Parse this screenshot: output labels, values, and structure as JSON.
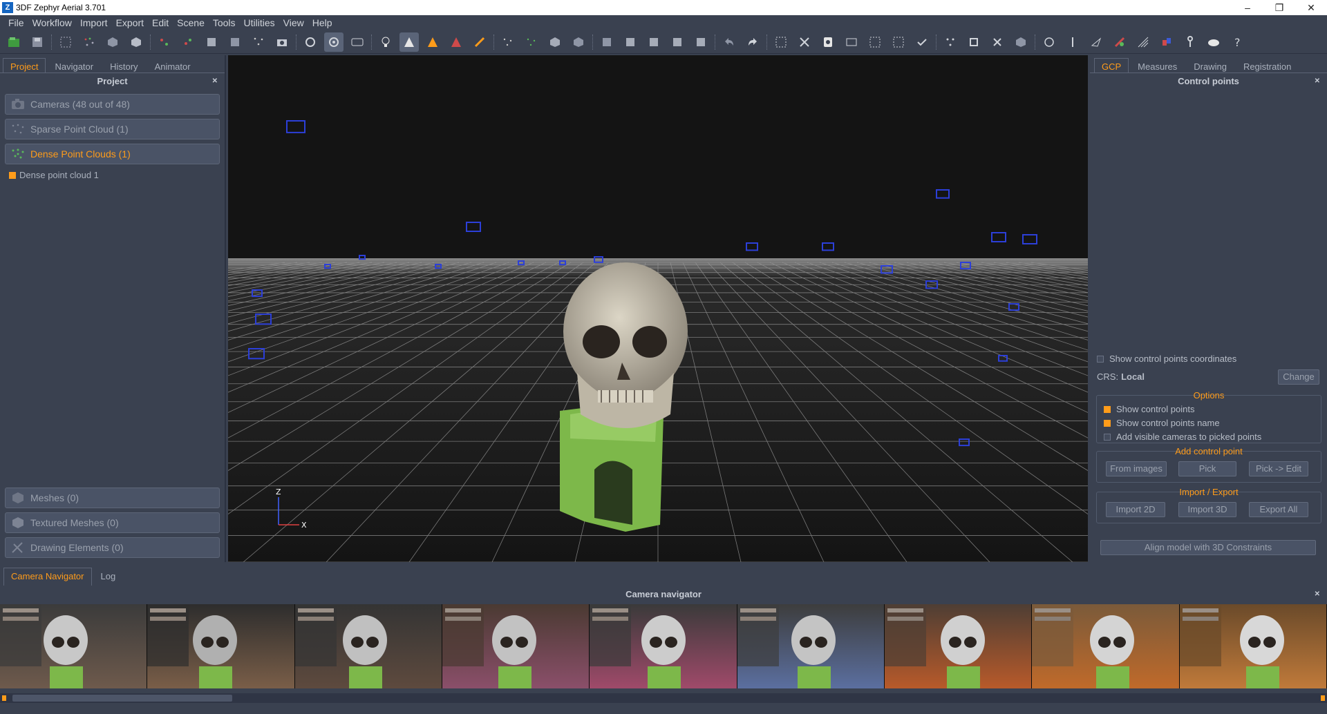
{
  "window": {
    "title": "3DF Zephyr Aerial 3.701",
    "logo_letter": "Z",
    "controls": [
      "–",
      "❐",
      "✕"
    ]
  },
  "menu": [
    "File",
    "Workflow",
    "Import",
    "Export",
    "Edit",
    "Scene",
    "Tools",
    "Utilities",
    "View",
    "Help"
  ],
  "left_panel": {
    "tabs": [
      "Project",
      "Navigator",
      "History",
      "Animator"
    ],
    "title": "Project",
    "sections_top": [
      {
        "label": "Cameras (48 out of 48)",
        "icon": "camera-icon"
      },
      {
        "label": "Sparse Point Cloud (1)",
        "icon": "sparse-cloud-icon"
      },
      {
        "label": "Dense Point Clouds (1)",
        "icon": "dense-cloud-icon"
      }
    ],
    "tree_item": "Dense point cloud 1",
    "sections_bottom": [
      {
        "label": "Meshes (0)",
        "icon": "mesh-icon"
      },
      {
        "label": "Textured Meshes (0)",
        "icon": "textured-mesh-icon"
      },
      {
        "label": "Drawing Elements (0)",
        "icon": "drawing-icon"
      }
    ]
  },
  "viewport": {
    "axis_z": "Z",
    "axis_x": "X"
  },
  "right_panel": {
    "tabs": [
      "GCP",
      "Measures",
      "Drawing",
      "Registration"
    ],
    "title": "Control points",
    "show_coords_label": "Show control points coordinates",
    "crs_prefix": "CRS:",
    "crs_value": "Local",
    "change_label": "Change",
    "options_title": "Options",
    "options": [
      {
        "label": "Show control points",
        "checked": true
      },
      {
        "label": "Show control points name",
        "checked": true
      },
      {
        "label": "Add visible cameras to picked points",
        "checked": false
      }
    ],
    "add_cp_title": "Add control point",
    "add_cp_buttons": [
      "From images",
      "Pick",
      "Pick -> Edit"
    ],
    "import_export_title": "Import / Export",
    "import_export_buttons": [
      "Import 2D",
      "Import 3D",
      "Export All"
    ],
    "align_label": "Align model with 3D Constraints"
  },
  "bottom": {
    "tabs": [
      "Camera Navigator",
      "Log"
    ],
    "title": "Camera navigator",
    "thumbnail_count": 9
  },
  "colors": {
    "accent": "#ff9c1a",
    "panel_bg": "#3a4150",
    "viewport_bg": "#181818"
  }
}
